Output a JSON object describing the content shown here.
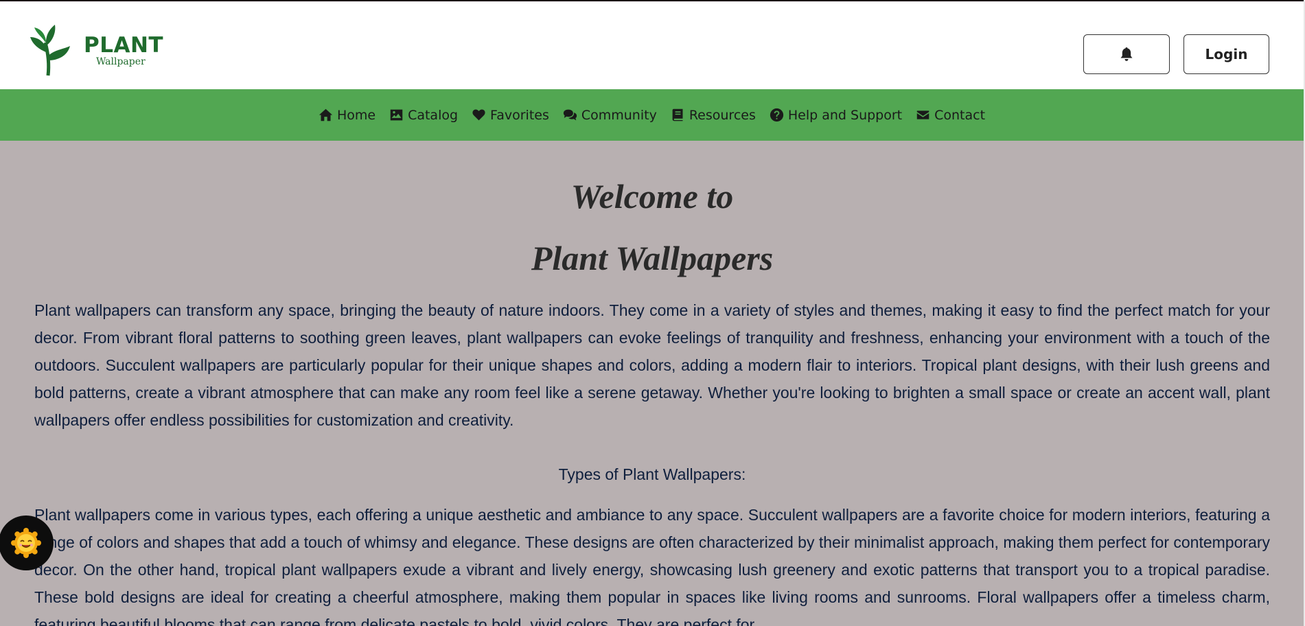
{
  "header": {
    "logo": {
      "title": "PLANT",
      "subtitle": "Wallpaper"
    },
    "notification_icon": "bell-icon",
    "login_label": "Login"
  },
  "nav": {
    "items": [
      {
        "label": "Home",
        "icon": "home-icon"
      },
      {
        "label": "Catalog",
        "icon": "image-icon"
      },
      {
        "label": "Favorites",
        "icon": "heart-icon"
      },
      {
        "label": "Community",
        "icon": "comments-icon"
      },
      {
        "label": "Resources",
        "icon": "book-icon"
      },
      {
        "label": "Help and Support",
        "icon": "question-circle-icon"
      },
      {
        "label": "Contact",
        "icon": "envelope-icon"
      }
    ]
  },
  "main": {
    "heading_line1": "Welcome to",
    "heading_line2": "Plant Wallpapers",
    "intro": "Plant wallpapers can transform any space, bringing the beauty of nature indoors. They come in a variety of styles and themes, making it easy to find the perfect match for your decor. From vibrant floral patterns to soothing green leaves, plant wallpapers can evoke feelings of tranquility and freshness, enhancing your environment with a touch of the outdoors. Succulent wallpapers are particularly popular for their unique shapes and colors, adding a modern flair to interiors. Tropical plant designs, with their lush greens and bold patterns, create a vibrant atmosphere that can make any room feel like a serene getaway. Whether you're looking to brighten a small space or create an accent wall, plant wallpapers offer endless possibilities for customization and creativity.",
    "types_heading": "Types of Plant Wallpapers:",
    "types_text": "Plant wallpapers come in various types, each offering a unique aesthetic and ambiance to any space. Succulent wallpapers are a favorite choice for modern interiors, featuring a range of colors and shapes that add a touch of whimsy and elegance. These designs are often characterized by their minimalist approach, making them perfect for contemporary decor. On the other hand, tropical plant wallpapers exude a vibrant and lively energy, showcasing lush greenery and exotic patterns that transport you to a tropical paradise. These bold designs are ideal for creating a cheerful atmosphere, making them popular in spaces like living rooms and sunrooms. Floral wallpapers offer a timeless charm, featuring beautiful blooms that can range from delicate pastels to bold, vivid colors. They are perfect for"
  },
  "theme_toggle": {
    "icon": "sun-smiley-icon"
  },
  "colors": {
    "nav_bg": "#52a752",
    "page_bg": "#b8b0b1",
    "logo_green": "#1f6b2d",
    "text": "#0f1f3d"
  }
}
